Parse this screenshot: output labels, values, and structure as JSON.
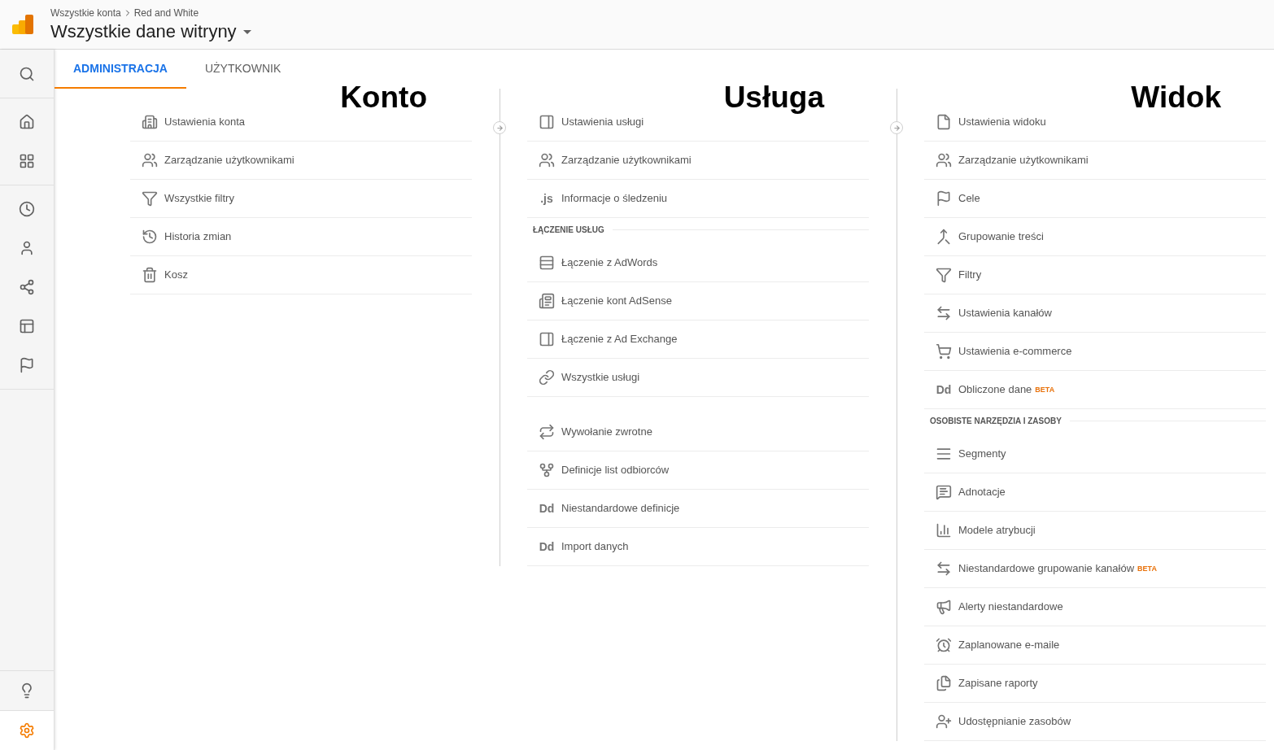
{
  "header": {
    "breadcrumb": [
      "Wszystkie konta",
      "Red and White"
    ],
    "title": "Wszystkie dane witryny"
  },
  "sidebar": {
    "top_groups": [
      [
        {
          "kind": "search",
          "selected": false
        }
      ],
      [
        {
          "kind": "home",
          "selected": false
        },
        {
          "kind": "dashboard",
          "selected": false
        }
      ],
      [
        {
          "kind": "clock",
          "selected": false
        },
        {
          "kind": "person",
          "selected": false
        },
        {
          "kind": "fork",
          "selected": false
        },
        {
          "kind": "layout",
          "selected": false
        },
        {
          "kind": "flag",
          "selected": false
        }
      ]
    ],
    "bottom_groups": [
      [
        {
          "kind": "bulb",
          "selected": false
        }
      ],
      [
        {
          "kind": "gear",
          "selected": true
        }
      ]
    ]
  },
  "tabs": [
    {
      "label": "ADMINISTRACJA",
      "selected": true
    },
    {
      "label": "UŻYTKOWNIK",
      "selected": false
    }
  ],
  "columns": [
    {
      "title": "Konto",
      "groups": [
        {
          "items": [
            {
              "kind": "building",
              "label": "Ustawienia konta"
            },
            {
              "kind": "users",
              "label": "Zarządzanie użytkownikami"
            },
            {
              "kind": "filter",
              "label": "Wszystkie filtry"
            },
            {
              "kind": "history",
              "label": "Historia zmian"
            },
            {
              "kind": "trash",
              "label": "Kosz"
            }
          ]
        }
      ]
    },
    {
      "title": "Usługa",
      "groups": [
        {
          "items": [
            {
              "kind": "panel",
              "label": "Ustawienia usługi"
            },
            {
              "kind": "users",
              "label": "Zarządzanie użytkownikami"
            },
            {
              "kind": "text",
              "icon_text": ".js",
              "label": "Informacje o śledzeniu"
            }
          ]
        },
        {
          "heading": "ŁĄCZENIE USŁUG",
          "items": [
            {
              "kind": "adwords",
              "label": "Łączenie z AdWords"
            },
            {
              "kind": "newspaper",
              "label": "Łączenie kont AdSense"
            },
            {
              "kind": "panel",
              "label": "Łączenie z Ad Exchange"
            },
            {
              "kind": "link",
              "label": "Wszystkie usługi"
            }
          ]
        },
        {
          "items": [
            {
              "kind": "repeat",
              "label": "Wywołanie zwrotne"
            },
            {
              "kind": "split",
              "label": "Definicje list odbiorców"
            },
            {
              "kind": "text",
              "icon_text": "Dd",
              "label": "Niestandardowe definicje"
            },
            {
              "kind": "text",
              "icon_text": "Dd",
              "label": "Import danych"
            }
          ]
        }
      ]
    },
    {
      "title": "Widok",
      "groups": [
        {
          "items": [
            {
              "kind": "file",
              "label": "Ustawienia widoku"
            },
            {
              "kind": "users",
              "label": "Zarządzanie użytkownikami"
            },
            {
              "kind": "flag",
              "label": "Cele"
            },
            {
              "kind": "merge",
              "label": "Grupowanie treści"
            },
            {
              "kind": "filter",
              "label": "Filtry"
            },
            {
              "kind": "channels",
              "label": "Ustawienia kanałów"
            },
            {
              "kind": "cart",
              "label": "Ustawienia e-commerce"
            },
            {
              "kind": "text",
              "icon_text": "Dd",
              "label": "Obliczone dane",
              "badge": "BETA"
            }
          ]
        },
        {
          "heading": "OSOBISTE NARZĘDZIA I ZASOBY",
          "items": [
            {
              "kind": "segments",
              "label": "Segmenty"
            },
            {
              "kind": "comment",
              "label": "Adnotacje"
            },
            {
              "kind": "bars",
              "label": "Modele atrybucji"
            },
            {
              "kind": "channels",
              "label": "Niestandardowe grupowanie kanałów",
              "badge": "BETA"
            },
            {
              "kind": "megaphone",
              "label": "Alerty niestandardowe"
            },
            {
              "kind": "alarm",
              "label": "Zaplanowane e-maile"
            },
            {
              "kind": "files",
              "label": "Zapisane raporty"
            },
            {
              "kind": "userplus",
              "label": "Udostępnianie zasobów"
            }
          ]
        }
      ]
    }
  ]
}
